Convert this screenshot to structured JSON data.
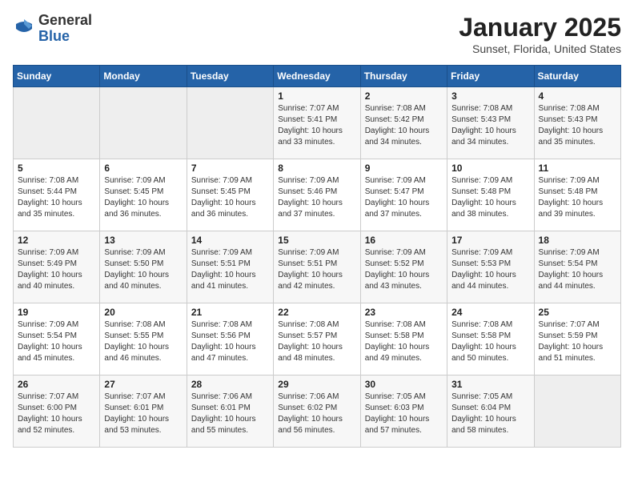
{
  "header": {
    "logo_general": "General",
    "logo_blue": "Blue",
    "title": "January 2025",
    "subtitle": "Sunset, Florida, United States"
  },
  "days_of_week": [
    "Sunday",
    "Monday",
    "Tuesday",
    "Wednesday",
    "Thursday",
    "Friday",
    "Saturday"
  ],
  "weeks": [
    [
      {
        "day": "",
        "info": ""
      },
      {
        "day": "",
        "info": ""
      },
      {
        "day": "",
        "info": ""
      },
      {
        "day": "1",
        "info": "Sunrise: 7:07 AM\nSunset: 5:41 PM\nDaylight: 10 hours\nand 33 minutes."
      },
      {
        "day": "2",
        "info": "Sunrise: 7:08 AM\nSunset: 5:42 PM\nDaylight: 10 hours\nand 34 minutes."
      },
      {
        "day": "3",
        "info": "Sunrise: 7:08 AM\nSunset: 5:43 PM\nDaylight: 10 hours\nand 34 minutes."
      },
      {
        "day": "4",
        "info": "Sunrise: 7:08 AM\nSunset: 5:43 PM\nDaylight: 10 hours\nand 35 minutes."
      }
    ],
    [
      {
        "day": "5",
        "info": "Sunrise: 7:08 AM\nSunset: 5:44 PM\nDaylight: 10 hours\nand 35 minutes."
      },
      {
        "day": "6",
        "info": "Sunrise: 7:09 AM\nSunset: 5:45 PM\nDaylight: 10 hours\nand 36 minutes."
      },
      {
        "day": "7",
        "info": "Sunrise: 7:09 AM\nSunset: 5:45 PM\nDaylight: 10 hours\nand 36 minutes."
      },
      {
        "day": "8",
        "info": "Sunrise: 7:09 AM\nSunset: 5:46 PM\nDaylight: 10 hours\nand 37 minutes."
      },
      {
        "day": "9",
        "info": "Sunrise: 7:09 AM\nSunset: 5:47 PM\nDaylight: 10 hours\nand 37 minutes."
      },
      {
        "day": "10",
        "info": "Sunrise: 7:09 AM\nSunset: 5:48 PM\nDaylight: 10 hours\nand 38 minutes."
      },
      {
        "day": "11",
        "info": "Sunrise: 7:09 AM\nSunset: 5:48 PM\nDaylight: 10 hours\nand 39 minutes."
      }
    ],
    [
      {
        "day": "12",
        "info": "Sunrise: 7:09 AM\nSunset: 5:49 PM\nDaylight: 10 hours\nand 40 minutes."
      },
      {
        "day": "13",
        "info": "Sunrise: 7:09 AM\nSunset: 5:50 PM\nDaylight: 10 hours\nand 40 minutes."
      },
      {
        "day": "14",
        "info": "Sunrise: 7:09 AM\nSunset: 5:51 PM\nDaylight: 10 hours\nand 41 minutes."
      },
      {
        "day": "15",
        "info": "Sunrise: 7:09 AM\nSunset: 5:51 PM\nDaylight: 10 hours\nand 42 minutes."
      },
      {
        "day": "16",
        "info": "Sunrise: 7:09 AM\nSunset: 5:52 PM\nDaylight: 10 hours\nand 43 minutes."
      },
      {
        "day": "17",
        "info": "Sunrise: 7:09 AM\nSunset: 5:53 PM\nDaylight: 10 hours\nand 44 minutes."
      },
      {
        "day": "18",
        "info": "Sunrise: 7:09 AM\nSunset: 5:54 PM\nDaylight: 10 hours\nand 44 minutes."
      }
    ],
    [
      {
        "day": "19",
        "info": "Sunrise: 7:09 AM\nSunset: 5:54 PM\nDaylight: 10 hours\nand 45 minutes."
      },
      {
        "day": "20",
        "info": "Sunrise: 7:08 AM\nSunset: 5:55 PM\nDaylight: 10 hours\nand 46 minutes."
      },
      {
        "day": "21",
        "info": "Sunrise: 7:08 AM\nSunset: 5:56 PM\nDaylight: 10 hours\nand 47 minutes."
      },
      {
        "day": "22",
        "info": "Sunrise: 7:08 AM\nSunset: 5:57 PM\nDaylight: 10 hours\nand 48 minutes."
      },
      {
        "day": "23",
        "info": "Sunrise: 7:08 AM\nSunset: 5:58 PM\nDaylight: 10 hours\nand 49 minutes."
      },
      {
        "day": "24",
        "info": "Sunrise: 7:08 AM\nSunset: 5:58 PM\nDaylight: 10 hours\nand 50 minutes."
      },
      {
        "day": "25",
        "info": "Sunrise: 7:07 AM\nSunset: 5:59 PM\nDaylight: 10 hours\nand 51 minutes."
      }
    ],
    [
      {
        "day": "26",
        "info": "Sunrise: 7:07 AM\nSunset: 6:00 PM\nDaylight: 10 hours\nand 52 minutes."
      },
      {
        "day": "27",
        "info": "Sunrise: 7:07 AM\nSunset: 6:01 PM\nDaylight: 10 hours\nand 53 minutes."
      },
      {
        "day": "28",
        "info": "Sunrise: 7:06 AM\nSunset: 6:01 PM\nDaylight: 10 hours\nand 55 minutes."
      },
      {
        "day": "29",
        "info": "Sunrise: 7:06 AM\nSunset: 6:02 PM\nDaylight: 10 hours\nand 56 minutes."
      },
      {
        "day": "30",
        "info": "Sunrise: 7:05 AM\nSunset: 6:03 PM\nDaylight: 10 hours\nand 57 minutes."
      },
      {
        "day": "31",
        "info": "Sunrise: 7:05 AM\nSunset: 6:04 PM\nDaylight: 10 hours\nand 58 minutes."
      },
      {
        "day": "",
        "info": ""
      }
    ]
  ]
}
